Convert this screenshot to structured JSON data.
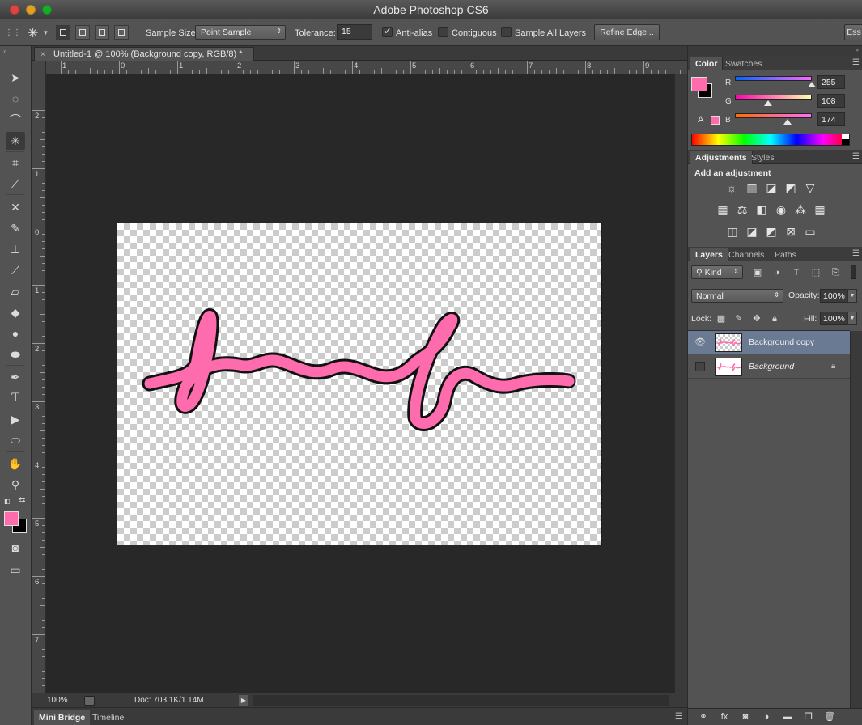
{
  "window": {
    "title": "Adobe Photoshop CS6"
  },
  "options_bar": {
    "sample_size_label": "Sample Size:",
    "sample_size_value": "Point Sample",
    "tolerance_label": "Tolerance:",
    "tolerance_value": "15",
    "anti_alias_label": "Anti-alias",
    "anti_alias_checked": true,
    "contiguous_label": "Contiguous",
    "contiguous_checked": false,
    "sample_all_layers_label": "Sample All Layers",
    "sample_all_layers_checked": false,
    "refine_edge_label": "Refine Edge...",
    "workspace_label": "Ess"
  },
  "document": {
    "tab_label": "Untitled-1 @ 100% (Background copy, RGB/8) *",
    "close_glyph": "×"
  },
  "rulers": {
    "horizontal_labels": [
      "1",
      "0",
      "1",
      "2",
      "3",
      "4",
      "5",
      "6",
      "7",
      "8",
      "9"
    ],
    "vertical_labels": [
      "2",
      "1",
      "0",
      "1",
      "2",
      "3",
      "4",
      "5",
      "6",
      "7"
    ]
  },
  "status": {
    "zoom": "100%",
    "doc_info": "Doc: 703.1K/1.14M"
  },
  "bottom_panel": {
    "tabs": [
      "Mini Bridge",
      "Timeline"
    ]
  },
  "color_panel": {
    "tabs": [
      "Color",
      "Swatches"
    ],
    "foreground": "#ff6cae",
    "background": "#000000",
    "r_label": "R",
    "r_value": "255",
    "g_label": "G",
    "g_value": "108",
    "b_label": "B",
    "b_value": "174"
  },
  "adjustments_panel": {
    "tabs": [
      "Adjustments",
      "Styles"
    ],
    "heading": "Add an adjustment"
  },
  "layers_panel": {
    "tabs": [
      "Layers",
      "Channels",
      "Paths"
    ],
    "filter_label": "Kind",
    "blend_mode": "Normal",
    "opacity_label": "Opacity:",
    "opacity_value": "100%",
    "lock_label": "Lock:",
    "fill_label": "Fill:",
    "fill_value": "100%",
    "layers": [
      {
        "name": "Background copy",
        "visible": true,
        "selected": true
      },
      {
        "name": "Background",
        "visible": false,
        "selected": false,
        "locked": true
      }
    ]
  },
  "stroke_color": "#ff6cae"
}
